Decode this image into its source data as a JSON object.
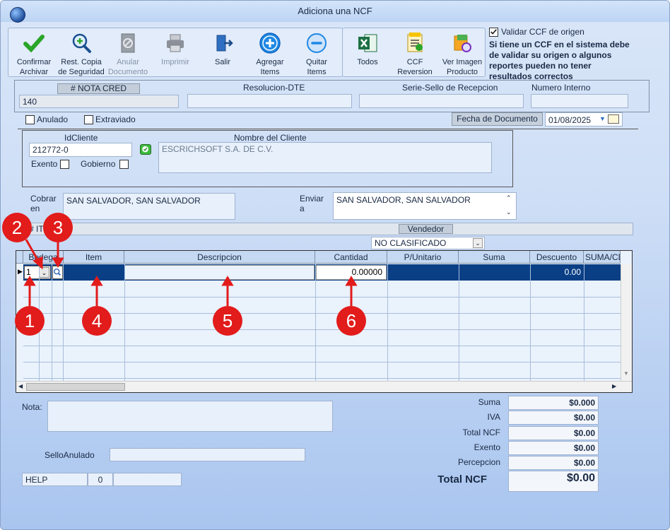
{
  "window": {
    "title": "Adiciona una NCF"
  },
  "toolbar": {
    "confirm": "Confirmar\nArchivar",
    "restore": "Rest. Copia\nde Seguridad",
    "cancel_doc": "Anular\nDocumento",
    "print": "Imprimir",
    "exit": "Salir",
    "add_items": "Agregar\nItems",
    "remove_items": "Quitar\nItems",
    "all": "Todos",
    "ccf_reversion": "CCF\nReversion",
    "view_image": "Ver Imagen\nProducto"
  },
  "validate": {
    "label": "Validar CCF de origen",
    "checked": true,
    "note": "Si tiene un CCF en el sistema debe de validar su origen o algunos reportes pueden no tener resultados correctos"
  },
  "header": {
    "nota_label": "# NOTA CRED",
    "nota_value": "140",
    "resolucion_label": "Resolucion-DTE",
    "resolucion_value": "",
    "serie_label": "Serie-Sello de Recepcion",
    "serie_value": "",
    "numero_label": "Numero Interno",
    "numero_value": ""
  },
  "flags": {
    "anulado": "Anulado",
    "extraviado": "Extraviado"
  },
  "fecha": {
    "label": "Fecha de  Documento",
    "value": "01/08/2025"
  },
  "cliente": {
    "id_label": "IdCliente",
    "id_value": "212772-0",
    "nombre_label": "Nombre del Cliente",
    "nombre_value": "ESCRICHSOFT S.A. DE C.V.",
    "exento": "Exento",
    "gobierno": "Gobierno"
  },
  "cobrar": {
    "label": "Cobrar\nen",
    "value": "SAN SALVADOR, SAN SALVADOR"
  },
  "enviar": {
    "label": "Enviar\na",
    "value": "SAN SALVADOR, SAN SALVADOR"
  },
  "items_label": "# IT",
  "vendedor": {
    "label": "Vendedor",
    "value": "NO CLASIFICADO"
  },
  "grid": {
    "columns": [
      "Bodega",
      "Item",
      "Descripcion",
      "Cantidad",
      "P/Unitario",
      "Suma",
      "Descuento",
      "SUMA/CD"
    ],
    "row": {
      "bodega": "1",
      "item": "",
      "descripcion": "",
      "cantidad": "0.00000",
      "punitario": "",
      "suma": "",
      "descuento": "0.00"
    }
  },
  "annotations": [
    "1",
    "2",
    "3",
    "4",
    "5",
    "6"
  ],
  "nota": {
    "label": "Nota:",
    "value": ""
  },
  "sello": {
    "label": "SelloAnulado",
    "value": ""
  },
  "status": {
    "help": "HELP",
    "count": "0",
    "extra": ""
  },
  "totals": {
    "suma_label": "Suma",
    "suma": "$0.000",
    "iva_label": "IVA",
    "iva": "$0.00",
    "total_ncf_label": "Total NCF",
    "total_ncf": "$0.00",
    "exento_label": "Exento",
    "exento": "$0.00",
    "percepcion_label": "Percepcion",
    "percepcion": "$0.00",
    "grand_label": "Total NCF",
    "grand": "$0.00"
  },
  "colors": {
    "accent": "#0a3f86",
    "annotation": "#e21b1b",
    "confirm": "#2aa52a",
    "add": "#1e88e5"
  }
}
